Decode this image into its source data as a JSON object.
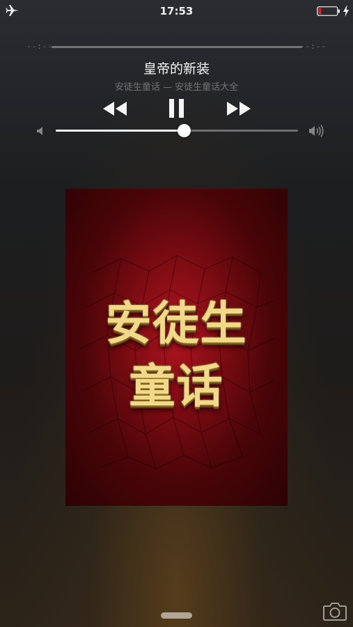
{
  "status_bar": {
    "time": "17:53",
    "airplane_icon": "airplane-icon",
    "battery_icon": "battery-low-icon",
    "charging_icon": "charging-bolt-icon",
    "battery_color": "#e0212e"
  },
  "now_playing": {
    "elapsed": "--:--",
    "remaining": "--:--",
    "title": "皇帝的新装",
    "subtitle": "安徒生童话 — 安徒生童话大全",
    "volume_level": 0.53
  },
  "controls": {
    "rewind_icon": "rewind-icon",
    "pause_icon": "pause-icon",
    "forward_icon": "fast-forward-icon"
  },
  "album_art": {
    "line1": "安徒生",
    "line2": "童话",
    "bg_color": "#7e0c13",
    "text_color": "#f2d98a"
  },
  "bottom": {
    "camera_icon": "camera-icon"
  }
}
